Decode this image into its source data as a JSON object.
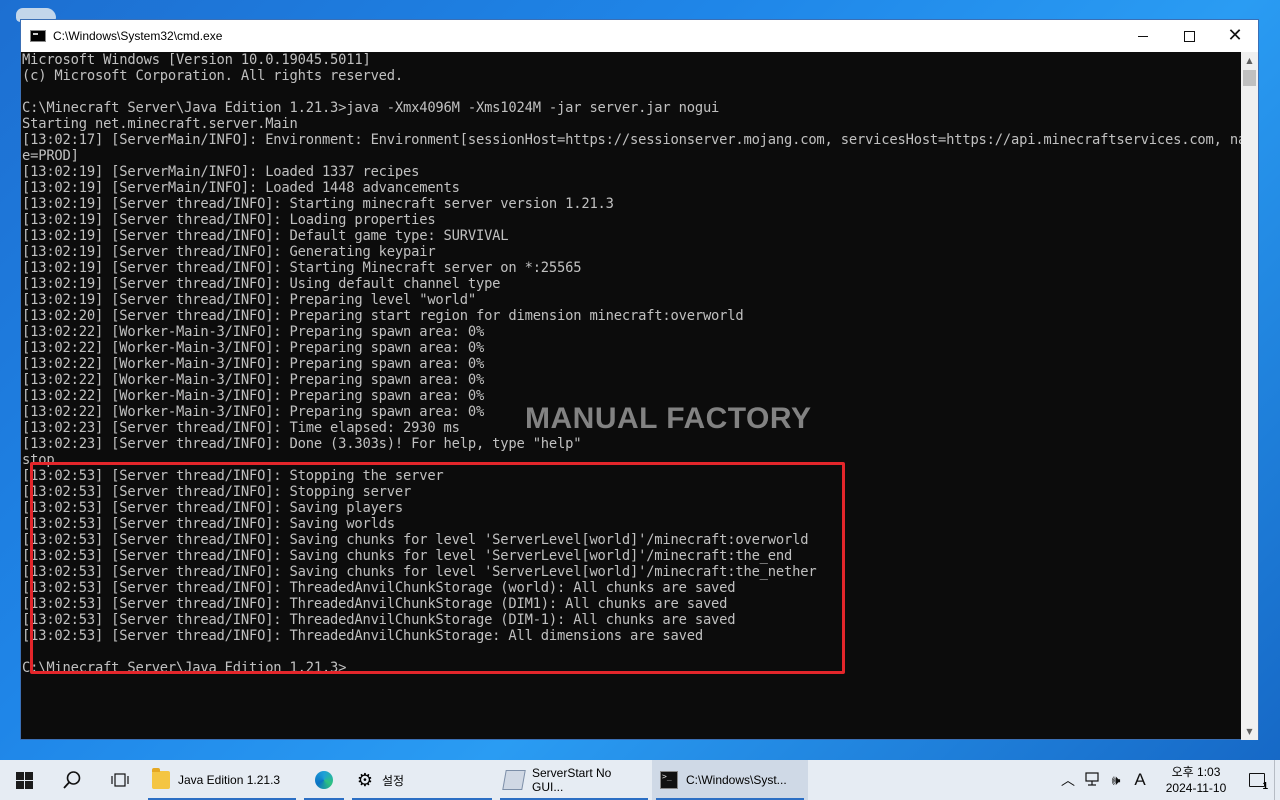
{
  "window": {
    "title": "C:\\Windows\\System32\\cmd.exe",
    "controls": {
      "minimize": "minimize",
      "maximize": "maximize",
      "close": "✕"
    }
  },
  "console": {
    "lines": [
      "Microsoft Windows [Version 10.0.19045.5011]",
      "(c) Microsoft Corporation. All rights reserved.",
      "",
      "C:\\Minecraft Server\\Java Edition 1.21.3>java -Xmx4096M -Xms1024M -jar server.jar nogui",
      "Starting net.minecraft.server.Main",
      "[13:02:17] [ServerMain/INFO]: Environment: Environment[sessionHost=https://sessionserver.mojang.com, servicesHost=https://api.minecraftservices.com, nam",
      "e=PROD]",
      "[13:02:19] [ServerMain/INFO]: Loaded 1337 recipes",
      "[13:02:19] [ServerMain/INFO]: Loaded 1448 advancements",
      "[13:02:19] [Server thread/INFO]: Starting minecraft server version 1.21.3",
      "[13:02:19] [Server thread/INFO]: Loading properties",
      "[13:02:19] [Server thread/INFO]: Default game type: SURVIVAL",
      "[13:02:19] [Server thread/INFO]: Generating keypair",
      "[13:02:19] [Server thread/INFO]: Starting Minecraft server on *:25565",
      "[13:02:19] [Server thread/INFO]: Using default channel type",
      "[13:02:19] [Server thread/INFO]: Preparing level \"world\"",
      "[13:02:20] [Server thread/INFO]: Preparing start region for dimension minecraft:overworld",
      "[13:02:22] [Worker-Main-3/INFO]: Preparing spawn area: 0%",
      "[13:02:22] [Worker-Main-3/INFO]: Preparing spawn area: 0%",
      "[13:02:22] [Worker-Main-3/INFO]: Preparing spawn area: 0%",
      "[13:02:22] [Worker-Main-3/INFO]: Preparing spawn area: 0%",
      "[13:02:22] [Worker-Main-3/INFO]: Preparing spawn area: 0%",
      "[13:02:22] [Worker-Main-3/INFO]: Preparing spawn area: 0%",
      "[13:02:23] [Server thread/INFO]: Time elapsed: 2930 ms",
      "[13:02:23] [Server thread/INFO]: Done (3.303s)! For help, type \"help\"",
      "stop",
      "[13:02:53] [Server thread/INFO]: Stopping the server",
      "[13:02:53] [Server thread/INFO]: Stopping server",
      "[13:02:53] [Server thread/INFO]: Saving players",
      "[13:02:53] [Server thread/INFO]: Saving worlds",
      "[13:02:53] [Server thread/INFO]: Saving chunks for level 'ServerLevel[world]'/minecraft:overworld",
      "[13:02:53] [Server thread/INFO]: Saving chunks for level 'ServerLevel[world]'/minecraft:the_end",
      "[13:02:53] [Server thread/INFO]: Saving chunks for level 'ServerLevel[world]'/minecraft:the_nether",
      "[13:02:53] [Server thread/INFO]: ThreadedAnvilChunkStorage (world): All chunks are saved",
      "[13:02:53] [Server thread/INFO]: ThreadedAnvilChunkStorage (DIM1): All chunks are saved",
      "[13:02:53] [Server thread/INFO]: ThreadedAnvilChunkStorage (DIM-1): All chunks are saved",
      "[13:02:53] [Server thread/INFO]: ThreadedAnvilChunkStorage: All dimensions are saved",
      "",
      "C:\\Minecraft Server\\Java Edition 1.21.3>"
    ],
    "text_color": "#c0c0c0",
    "background": "#0c0c0c"
  },
  "watermark": "MANUAL FACTORY",
  "highlight_color": "#e4262b",
  "taskbar": {
    "apps": [
      {
        "label": "Java Edition 1.21.3",
        "icon": "folder-icon"
      },
      {
        "label": "",
        "icon": "edge-icon"
      },
      {
        "label": "설정",
        "icon": "gear-icon"
      },
      {
        "label": "ServerStart No GUI...",
        "icon": "script-icon"
      },
      {
        "label": "C:\\Windows\\Syst...",
        "icon": "cmd-icon"
      }
    ],
    "tray": {
      "ime": "A",
      "time": "오후 1:03",
      "date": "2024-11-10",
      "notification_count": "1"
    }
  }
}
